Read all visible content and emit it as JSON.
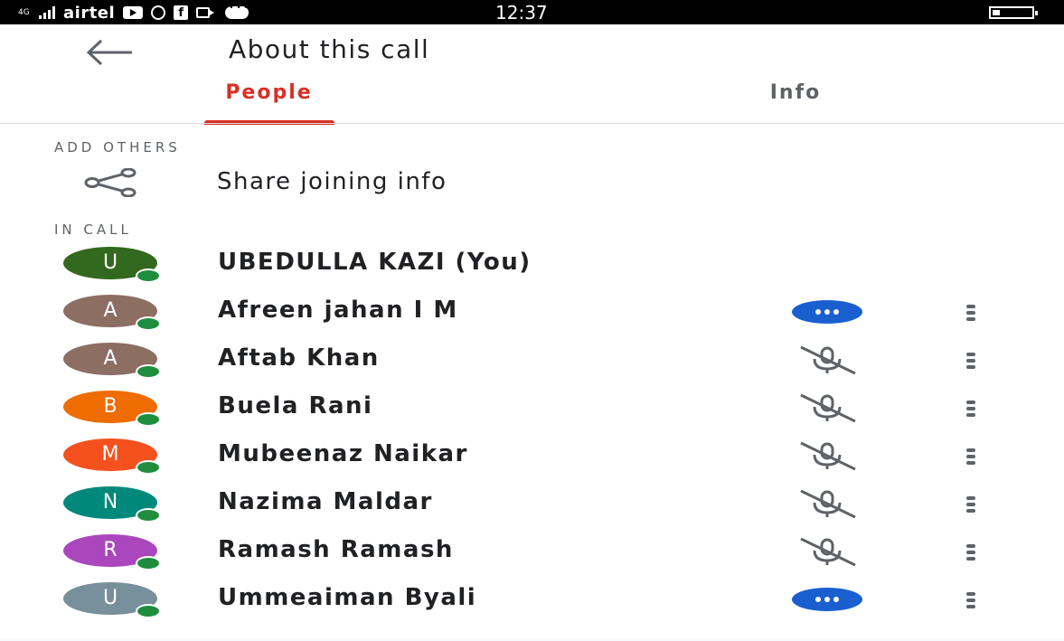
{
  "status_bar": {
    "network": "4G",
    "carrier": "airtel",
    "time": "12:37"
  },
  "header": {
    "title": "About this call"
  },
  "tabs": [
    {
      "label": "People",
      "active": true
    },
    {
      "label": "Info",
      "active": false
    }
  ],
  "add_others": {
    "section_label": "ADD OTHERS",
    "share_label": "Share joining info"
  },
  "in_call": {
    "section_label": "IN CALL",
    "participants": [
      {
        "initial": "U",
        "name": "UBEDULLA KAZI (You)",
        "color": "#33691e",
        "status": "none"
      },
      {
        "initial": "A",
        "name": "Afreen jahan I M",
        "color": "#8d6e63",
        "status": "speaking"
      },
      {
        "initial": "A",
        "name": "Aftab Khan",
        "color": "#8d6e63",
        "status": "muted"
      },
      {
        "initial": "B",
        "name": "Buela Rani",
        "color": "#ef6c00",
        "status": "muted"
      },
      {
        "initial": "M",
        "name": "Mubeenaz Naikar",
        "color": "#f4511e",
        "status": "muted"
      },
      {
        "initial": "N",
        "name": "Nazima Maldar",
        "color": "#00897b",
        "status": "muted"
      },
      {
        "initial": "R",
        "name": "Ramash Ramash",
        "color": "#ab47bc",
        "status": "muted"
      },
      {
        "initial": "U",
        "name": "Ummeaiman Byali",
        "color": "#78909c",
        "status": "speaking"
      }
    ]
  },
  "colors": {
    "accent": "#d93025",
    "speaking": "#1a5fd0",
    "online": "#1e8e3e"
  }
}
